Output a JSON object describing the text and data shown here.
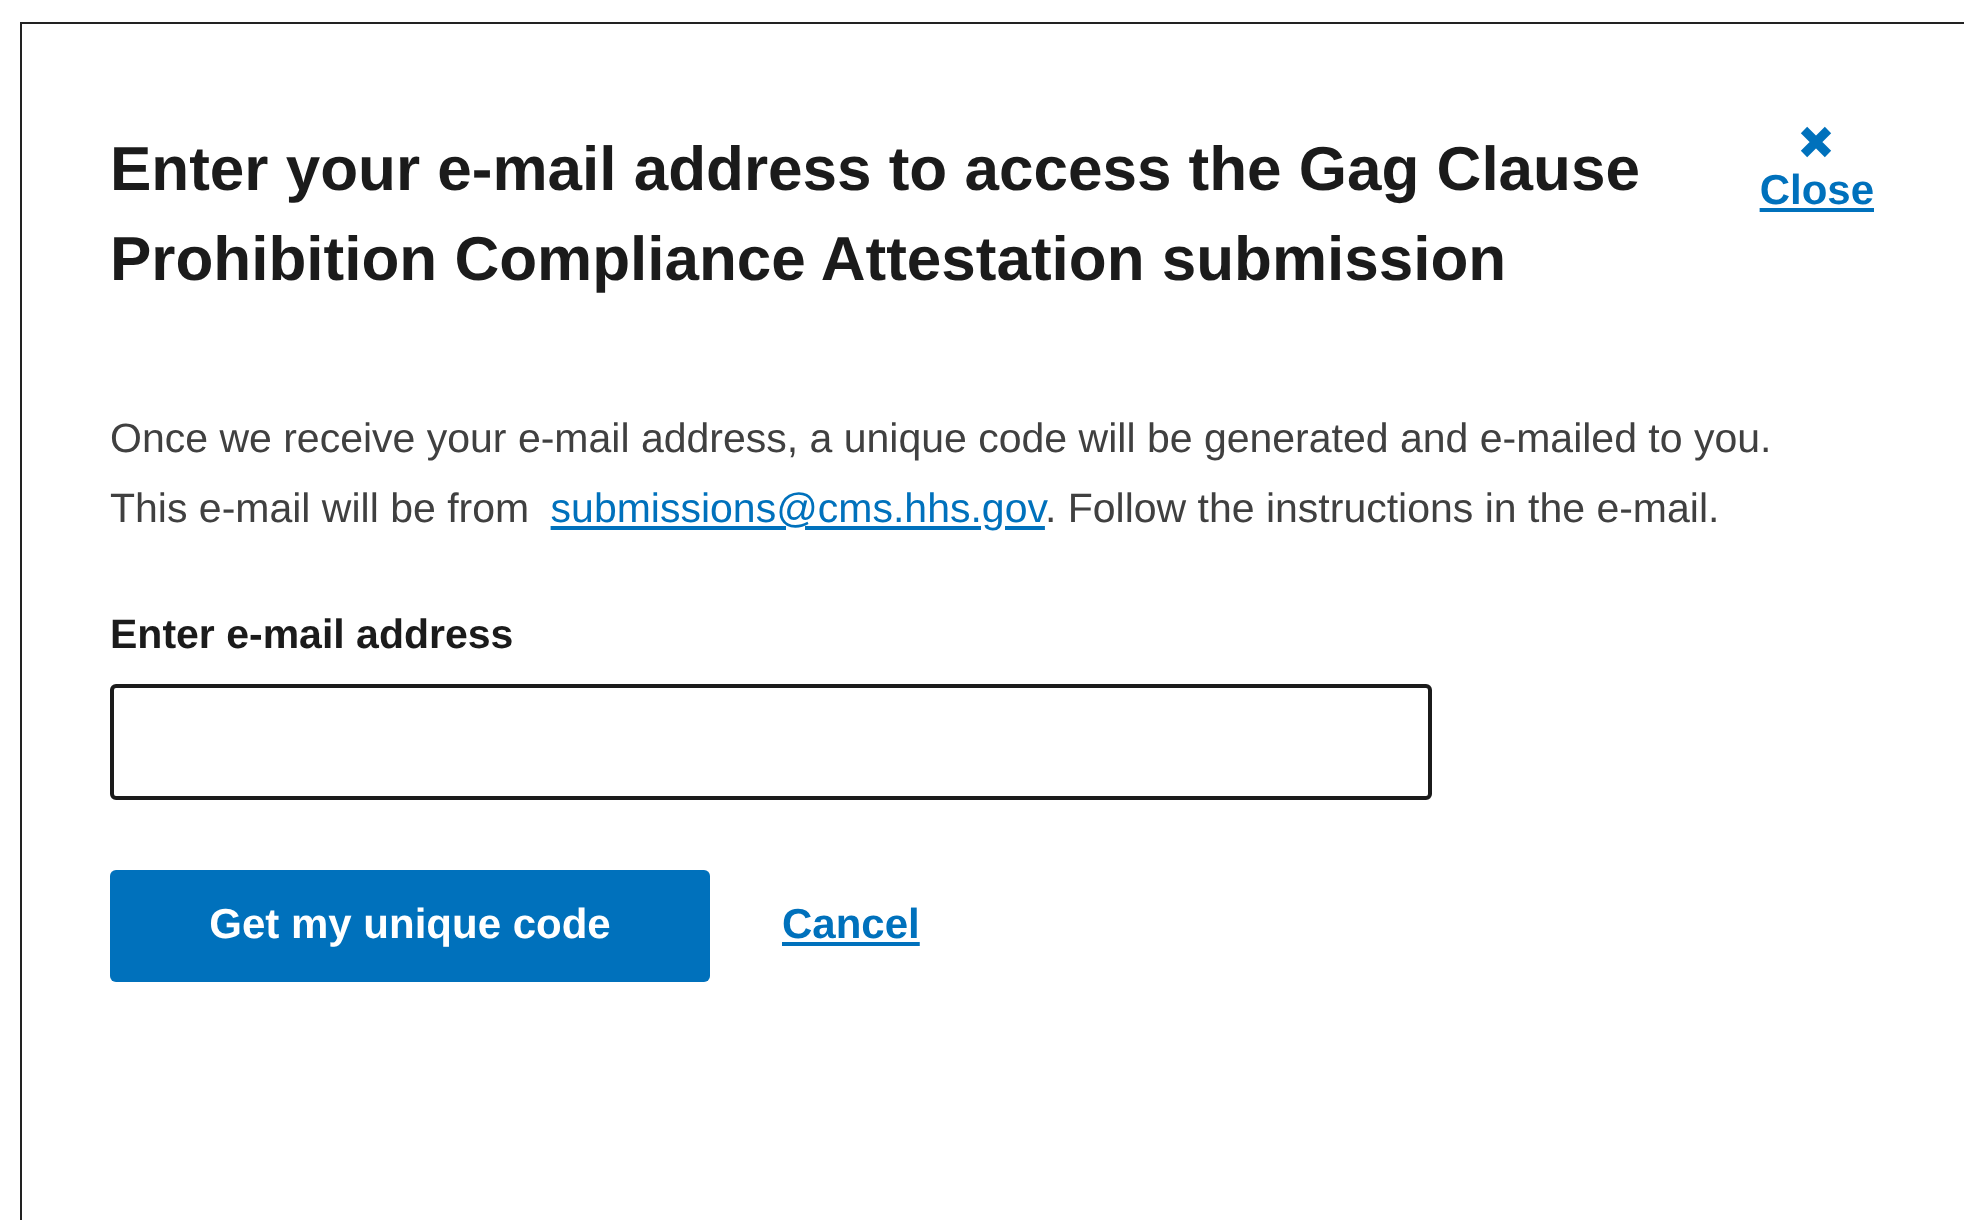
{
  "dialog": {
    "title": "Enter your e-mail address to access the Gag Clause Prohibition Compliance Attestation submission",
    "close_label": "Close",
    "message": {
      "before": "Once we receive your e-mail address, a unique code will be generated and e-mailed to you. This e-mail will be from ",
      "link": "submissions@cms.hhs.gov",
      "after": ". Follow the instructions in the e-mail."
    },
    "email_field": {
      "label": "Enter e-mail address"
    },
    "submit_button": "Get my unique code",
    "cancel_link": "Cancel"
  }
}
